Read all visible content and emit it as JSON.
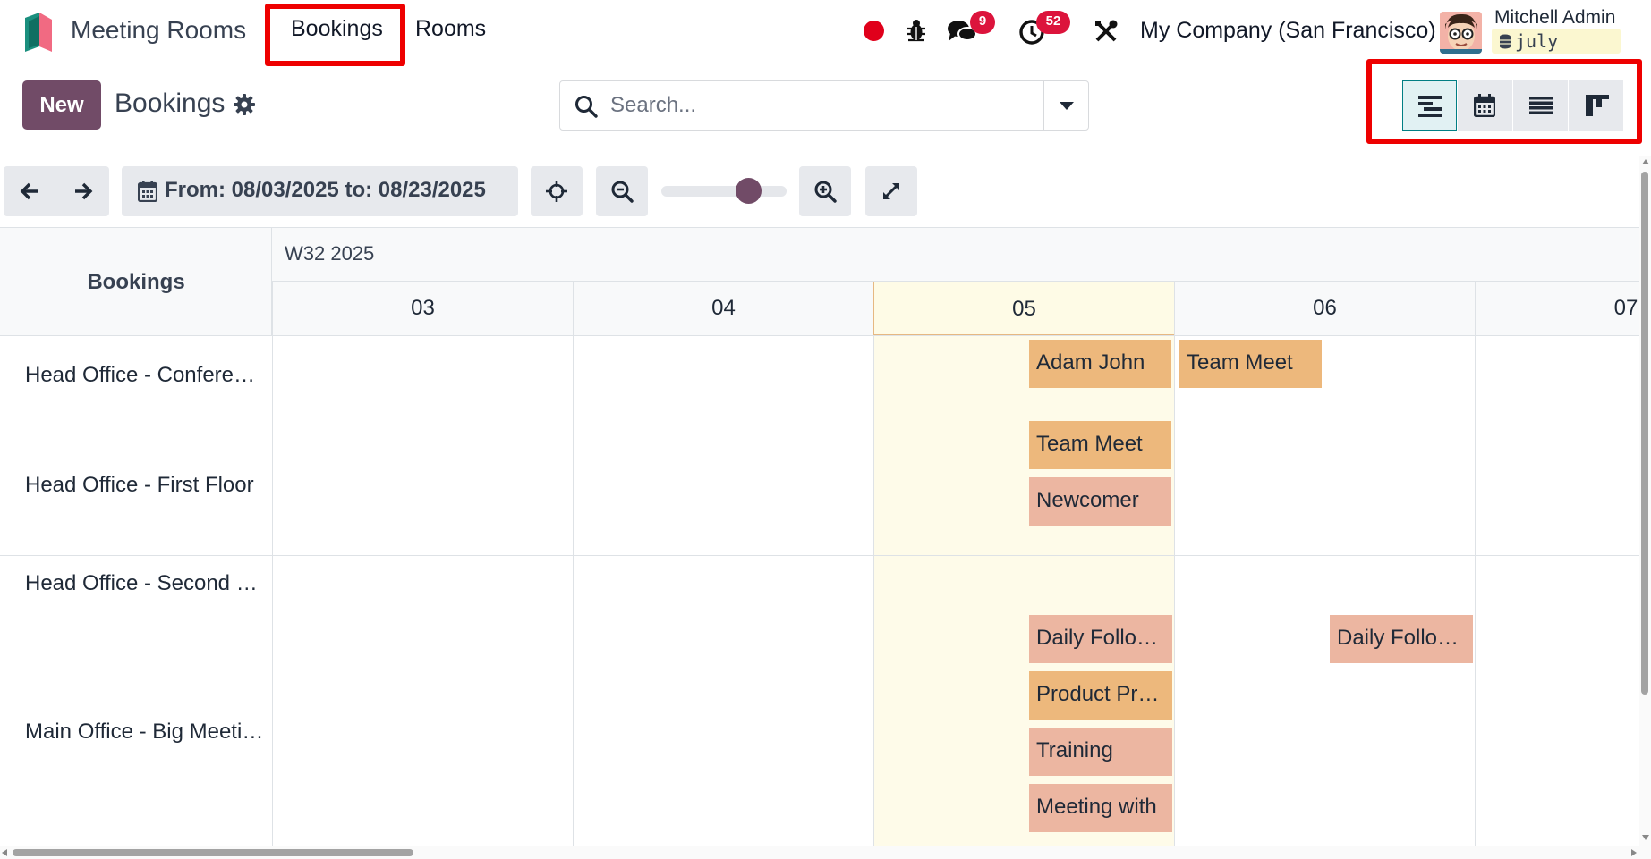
{
  "navbar": {
    "app_name": "Meeting Rooms",
    "menus": [
      "Bookings",
      "Rooms"
    ],
    "messages_count": "9",
    "activities_count": "52",
    "company": "My Company (San Francisco)",
    "user": {
      "name": "Mitchell Admin",
      "database": "july"
    }
  },
  "control_panel": {
    "new_label": "New",
    "title": "Bookings",
    "search_placeholder": "Search...",
    "views": [
      "gantt-icon",
      "calendar-icon",
      "list-icon",
      "kanban-icon"
    ],
    "active_view": "gantt"
  },
  "gantt": {
    "range_label": "From: 08/03/2025 to: 08/23/2025",
    "zoom_level": 0.75,
    "row_header": "Bookings",
    "week_label": "W32 2025",
    "days": [
      "03",
      "04",
      "05",
      "06",
      "07"
    ],
    "today": "05",
    "rows": [
      {
        "label": "Head Office - Conference Room",
        "bookings": [
          "Adam John",
          "Team Meet"
        ]
      },
      {
        "label": "Head Office - First Floor",
        "bookings": [
          "Team Meet",
          "Newcomer"
        ]
      },
      {
        "label": "Head Office - Second Floor",
        "bookings": []
      },
      {
        "label": "Main Office - Big Meeting Room",
        "bookings": [
          "Daily Follow-up",
          "Daily Follow-up",
          "Product Presentation",
          "Training",
          "Meeting with"
        ]
      }
    ]
  },
  "colors": {
    "brand": "#714b67",
    "highlight": "#ee0000",
    "badge": "#dc143c",
    "pill_orange": "#edb87c",
    "pill_salmon": "#ecb6a1",
    "today_bg": "#fefbe9"
  }
}
